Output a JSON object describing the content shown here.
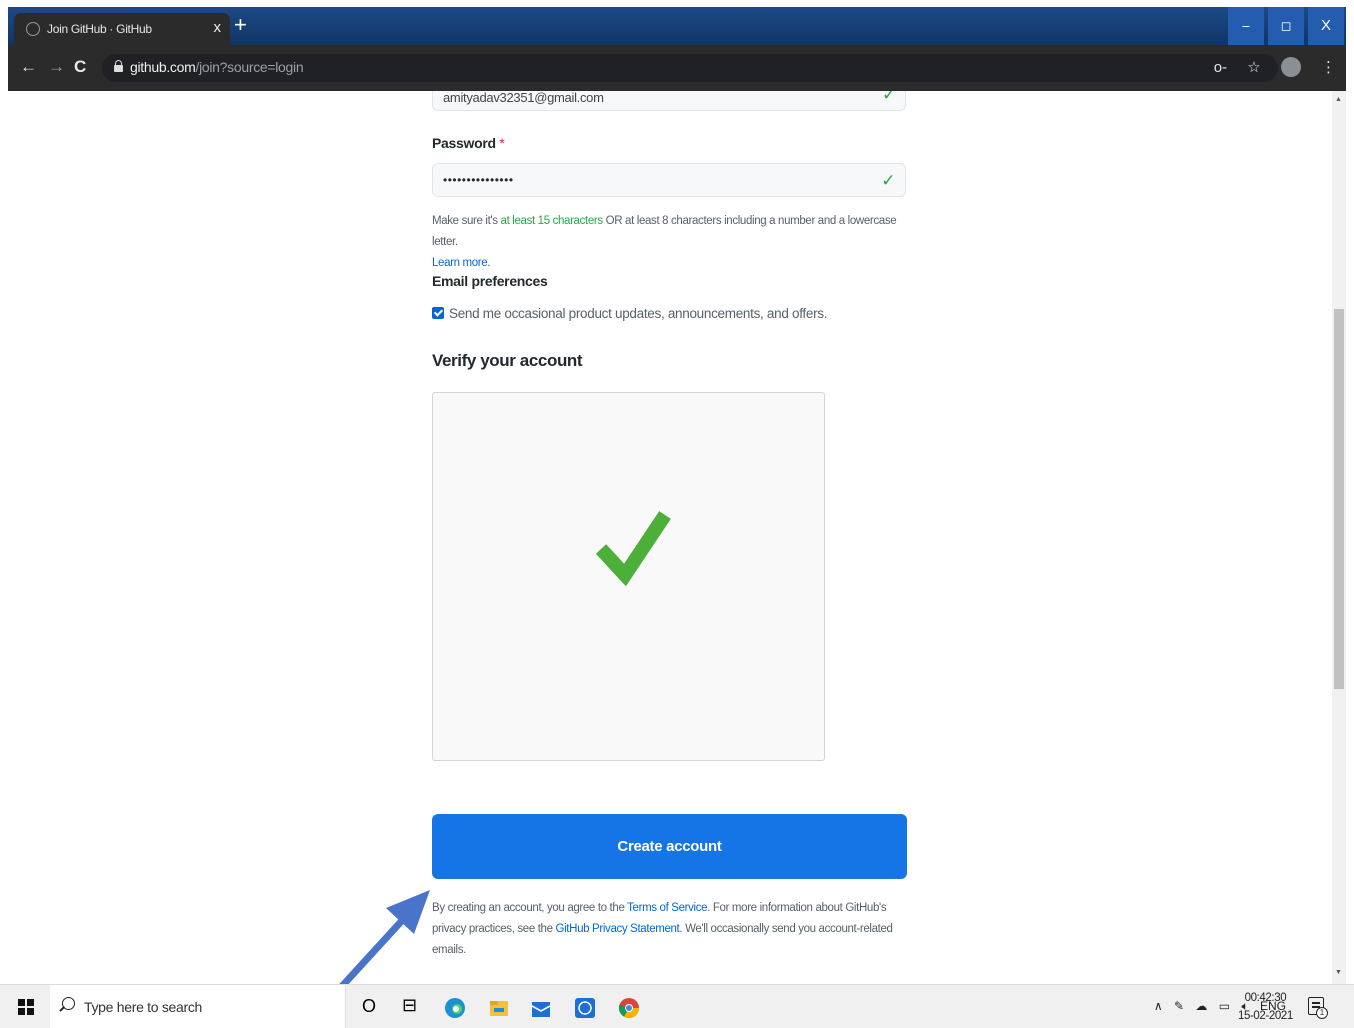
{
  "browser": {
    "tab_title": "Join GitHub · GitHub",
    "tab_close": "x",
    "new_tab": "+",
    "url_host": "github.com",
    "url_path": "/join?source=login",
    "window_min": "–",
    "window_max": "◻",
    "window_close": "X",
    "back": "←",
    "forward": "→",
    "reload": "C",
    "key_icon": "o-",
    "star_icon": "☆",
    "menu_icon": "⋮"
  },
  "form": {
    "email_value": "amityadav32351@gmail.com",
    "password_label": "Password",
    "required_mark": "*",
    "password_value": "•••••••••••••••",
    "hint_pre": "Make sure it's ",
    "hint_green": "at least 15 characters",
    "hint_post": " OR at least 8 characters including a number and a lowercase letter.",
    "learn_more": "Learn more.",
    "email_pref_label": "Email preferences",
    "email_pref_checkbox": "Send me occasional product updates, announcements, and offers.",
    "verify_title": "Verify your account",
    "create_button": "Create account",
    "terms_1": "By creating an account, you agree to the ",
    "terms_link_1": "Terms of Service",
    "terms_2": ". For more information about GitHub's privacy practices, see the ",
    "terms_link_2": "GitHub Privacy Statement",
    "terms_3": ". We'll occasionally send you account-related emails."
  },
  "taskbar": {
    "search_placeholder": "Type here to search",
    "cortana": "O",
    "task_view": "⊟",
    "tray_caret": "∧",
    "lang": "ENG",
    "time": "00:42:30",
    "date": "15-02-2021",
    "notification_count": "1"
  },
  "colors": {
    "primary_blue": "#1574e6",
    "success_green": "#28a745",
    "link_blue": "#0366d6",
    "annotation_arrow": "#4a74c9"
  }
}
